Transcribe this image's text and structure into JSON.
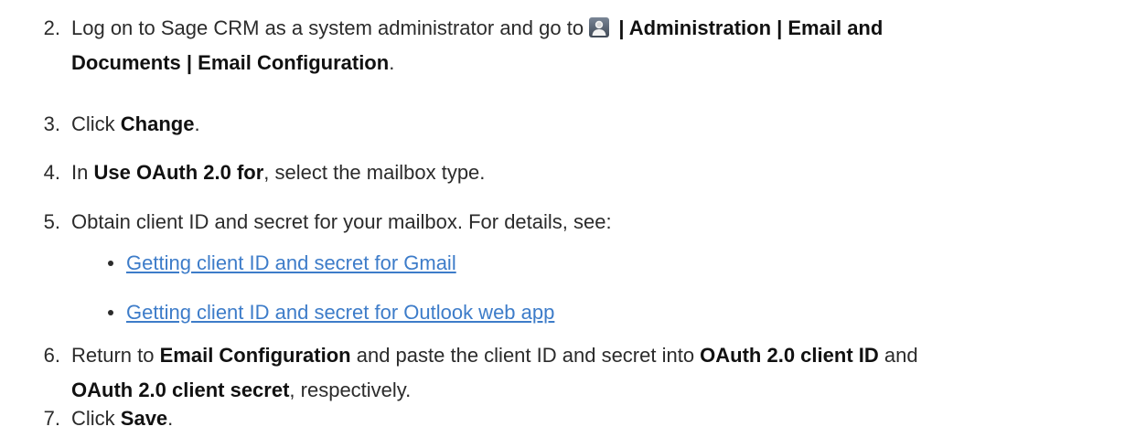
{
  "steps": [
    {
      "num": "2.",
      "line1_pre": "Log on to Sage CRM as a system administrator and go to",
      "line1_bold": "| Administration | Email and",
      "line2_bold": "Documents | Email Configuration",
      "line2_post": ".",
      "icon": "admin-user-icon"
    },
    {
      "num": "3.",
      "pre": "Click ",
      "bold": "Change",
      "post": "."
    },
    {
      "num": "4.",
      "pre": "In ",
      "bold": "Use OAuth 2.0 for",
      "post": ", select the mailbox type."
    },
    {
      "num": "5.",
      "text": "Obtain client ID and secret for your mailbox. For details, see:",
      "links": [
        "Getting client ID and secret for Gmail",
        "Getting client ID and secret for Outlook web app"
      ]
    },
    {
      "num": "6.",
      "pre": "Return to ",
      "bold1": "Email Configuration",
      "mid": " and paste the client ID and secret into ",
      "bold2": "OAuth 2.0 client ID",
      "post1": " and",
      "bold3": "OAuth 2.0 client secret",
      "post2": ", respectively."
    },
    {
      "num": "7.",
      "pre": "Click ",
      "bold": "Save",
      "post": "."
    }
  ],
  "colors": {
    "text": "#2b2b2b",
    "link": "#3d7cc9"
  }
}
